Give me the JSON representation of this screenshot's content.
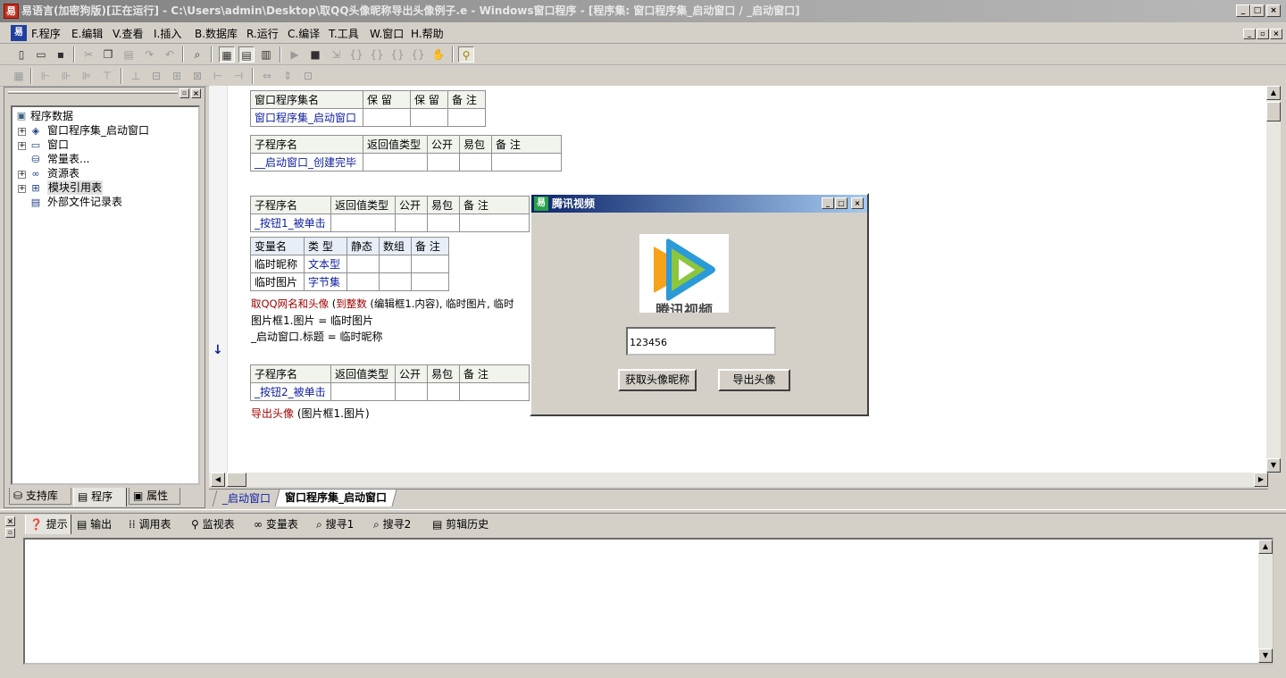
{
  "window": {
    "title": "易语言(加密狗版)[正在运行] - C:\\Users\\admin\\Desktop\\取QQ头像昵称导出头像例子.e - Windows窗口程序 - [程序集: 窗口程序集_启动窗口 / _启动窗口]",
    "app_icon": "易"
  },
  "menu": [
    "F.程序",
    "E.编辑",
    "V.查看",
    "I.插入",
    "B.数据库",
    "R.运行",
    "C.编译",
    "T.工具",
    "W.窗口",
    "H.帮助"
  ],
  "tree": {
    "root": "程序数据",
    "items": [
      "窗口程序集_启动窗口",
      "窗口",
      "常量表...",
      "资源表",
      "模块引用表",
      "外部文件记录表"
    ]
  },
  "left_tabs": [
    "支持库",
    "程序",
    "属性"
  ],
  "assembly_table": {
    "headers": [
      "窗口程序集名",
      "保 留",
      "保 留",
      "备 注"
    ],
    "row": [
      "窗口程序集_启动窗口",
      "",
      "",
      ""
    ]
  },
  "sub1": {
    "headers": [
      "子程序名",
      "返回值类型",
      "公开",
      "易包",
      "备 注"
    ],
    "row": [
      "__启动窗口_创建完毕",
      "",
      "",
      "",
      ""
    ]
  },
  "sub2": {
    "headers": [
      "子程序名",
      "返回值类型",
      "公开",
      "易包",
      "备 注"
    ],
    "row": [
      "_按钮1_被单击",
      "",
      "",
      "",
      ""
    ]
  },
  "vars": {
    "headers": [
      "变量名",
      "类 型",
      "静态",
      "数组",
      "备 注"
    ],
    "rows": [
      [
        "临时昵称",
        "文本型",
        "",
        "",
        ""
      ],
      [
        "临时图片",
        "字节集",
        "",
        "",
        ""
      ]
    ]
  },
  "code1": {
    "call": "取QQ网名和头像",
    "fn": "到整数",
    "rest": "(编辑框1.内容), 临时图片, 临时",
    "line2": "图片框1.图片 = 临时图片",
    "line3": "_启动窗口.标题 = 临时昵称"
  },
  "sub3": {
    "headers": [
      "子程序名",
      "返回值类型",
      "公开",
      "易包",
      "备 注"
    ],
    "row": [
      "_按钮2_被单击",
      "",
      "",
      "",
      ""
    ]
  },
  "code2": {
    "call": "导出头像",
    "rest": "(图片框1.图片)"
  },
  "gutter_arrow": "↓",
  "editor_tabs": [
    "_启动窗口",
    "窗口程序集_启动窗口"
  ],
  "dialog": {
    "title": "腾讯视频",
    "logo_text": "腾讯视频",
    "input_value": "123456",
    "btn1": "获取头像昵称",
    "btn2": "导出头像"
  },
  "bottom_tabs": [
    "提示",
    "输出",
    "调用表",
    "监视表",
    "变量表",
    "搜寻1",
    "搜寻2",
    "剪辑历史"
  ]
}
